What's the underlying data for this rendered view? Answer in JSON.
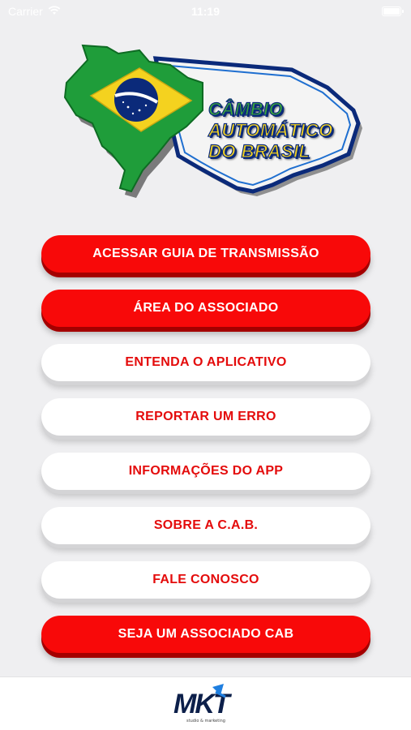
{
  "status_bar": {
    "carrier": "Carrier",
    "time": "11:19"
  },
  "logo": {
    "line1": "CÂMBIO",
    "line2": "AUTOMÁTICO",
    "line3": "DO BRASIL",
    "colors": {
      "green": "#1f9d3a",
      "yellow": "#f4d21f",
      "blue": "#0b2a7a"
    }
  },
  "menu": {
    "items": [
      {
        "label": "ACESSAR GUIA DE TRANSMISSÃO",
        "style": "red"
      },
      {
        "label": "ÁREA DO ASSOCIADO",
        "style": "red"
      },
      {
        "label": "ENTENDA O APLICATIVO",
        "style": "white"
      },
      {
        "label": "REPORTAR UM ERRO",
        "style": "white"
      },
      {
        "label": "INFORMAÇÕES DO APP",
        "style": "white"
      },
      {
        "label": "SOBRE A C.A.B.",
        "style": "white"
      },
      {
        "label": "FALE CONOSCO",
        "style": "white"
      },
      {
        "label": "SEJA UM ASSOCIADO CAB",
        "style": "red"
      }
    ],
    "colors": {
      "red": "#f80909",
      "text_red": "#e40b0b",
      "white": "#ffffff"
    }
  },
  "footer": {
    "brand": "MKT",
    "tagline": "studio & marketing"
  }
}
